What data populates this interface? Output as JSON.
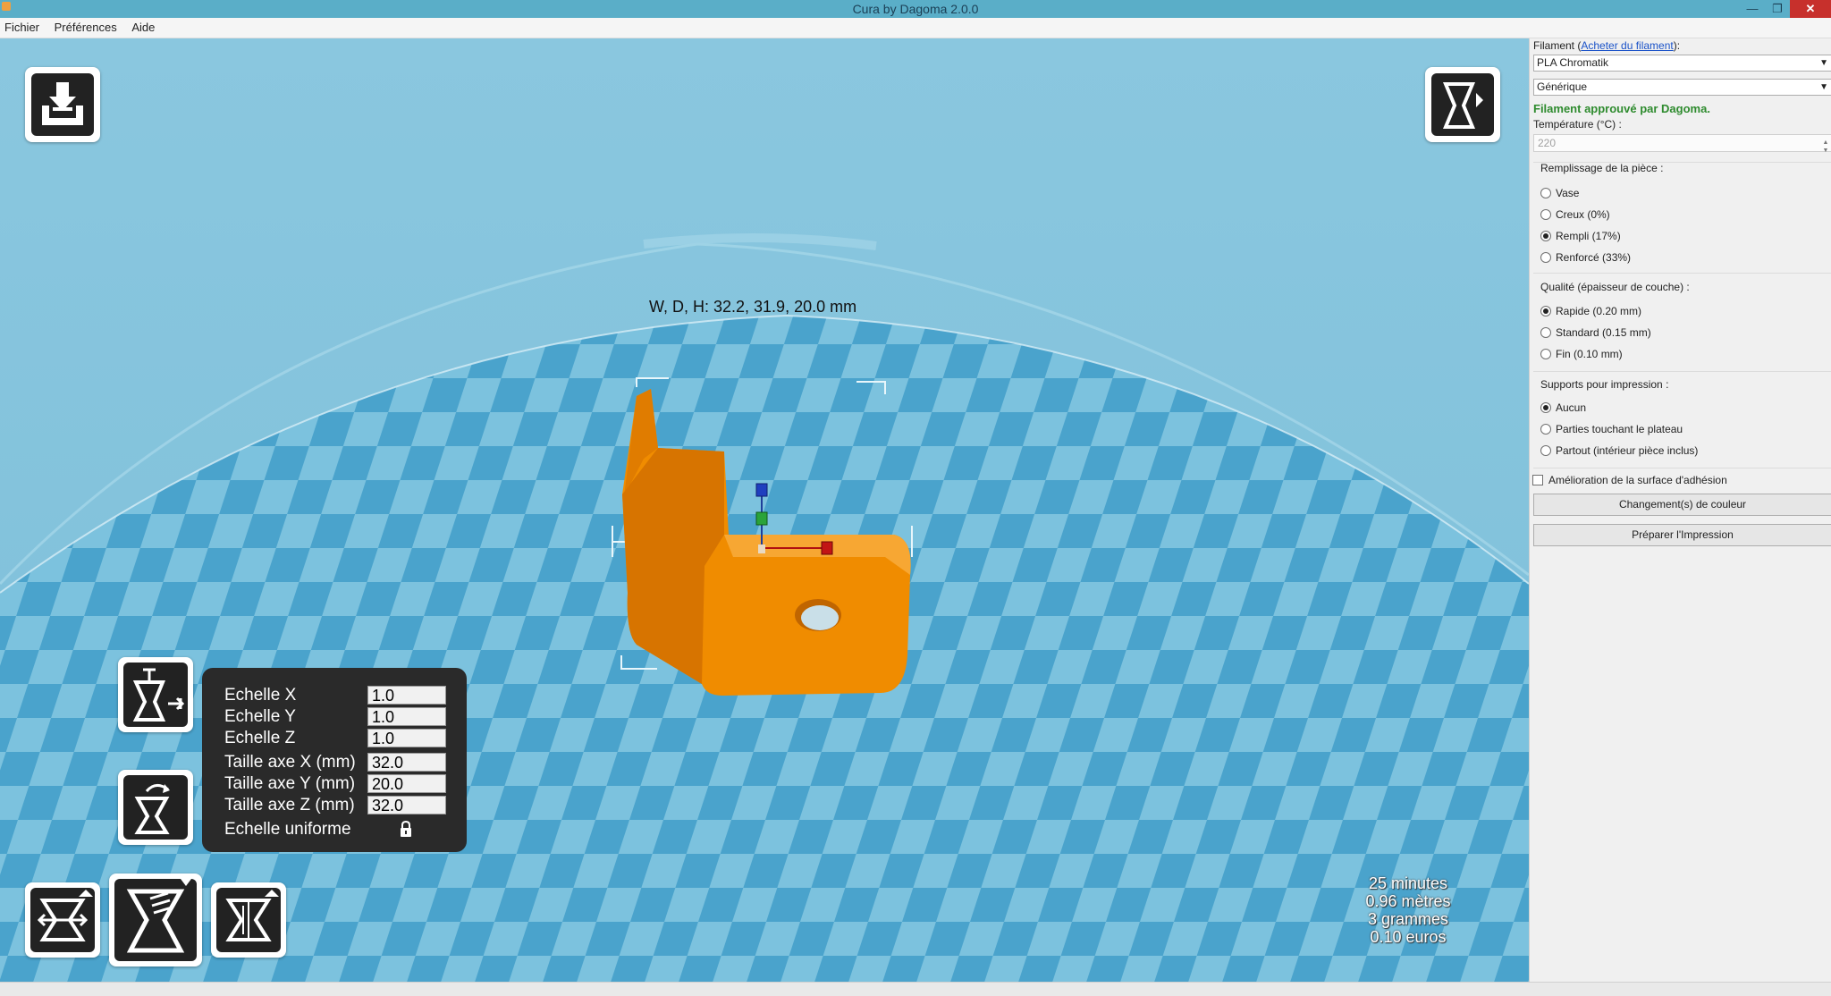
{
  "window": {
    "title": "Cura by Dagoma 2.0.0",
    "minimize": "—",
    "maximize": "❐",
    "close": "✕"
  },
  "menu": {
    "file": "Fichier",
    "preferences": "Préférences",
    "help": "Aide"
  },
  "viewport": {
    "dimensions_label": "W, D, H: 32.2, 31.9, 20.0 mm",
    "stats": {
      "time": "25 minutes",
      "length": "0.96 mètres",
      "weight": "3 grammes",
      "cost": "0.10 euros"
    }
  },
  "scale_panel": {
    "scale_x_label": "Echelle X",
    "scale_x_value": "1.0",
    "scale_y_label": "Echelle Y",
    "scale_y_value": "1.0",
    "scale_z_label": "Echelle Z",
    "scale_z_value": "1.0",
    "size_x_label": "Taille axe X (mm)",
    "size_x_value": "32.0",
    "size_y_label": "Taille axe Y (mm)",
    "size_y_value": "20.0",
    "size_z_label": "Taille axe Z (mm)",
    "size_z_value": "32.0",
    "uniform_label": "Echelle uniforme"
  },
  "sidepanel": {
    "filament_label_prefix": "Filament (",
    "filament_link": "Acheter du filament",
    "filament_label_suffix": "):",
    "filament_select": "PLA Chromatik",
    "color_select": "Générique",
    "approved_text": "Filament approuvé par Dagoma.",
    "temperature_label": "Température (°C) :",
    "temperature_value": "220",
    "infill": {
      "title": "Remplissage de la pièce :",
      "options": [
        "Vase",
        "Creux (0%)",
        "Rempli (17%)",
        "Renforcé (33%)"
      ],
      "selected": 2
    },
    "quality": {
      "title": "Qualité (épaisseur de couche) :",
      "options": [
        "Rapide (0.20 mm)",
        "Standard (0.15 mm)",
        "Fin (0.10 mm)"
      ],
      "selected": 0
    },
    "supports": {
      "title": "Supports pour impression :",
      "options": [
        "Aucun",
        "Parties touchant le plateau",
        "Partout (intérieur pièce inclus)"
      ],
      "selected": 0
    },
    "adhesion_label": "Amélioration de la surface d'adhésion",
    "adhesion_checked": false,
    "color_change_button": "Changement(s) de couleur",
    "prepare_button": "Préparer l'Impression"
  },
  "colors": {
    "accent_green": "#2e8b2e",
    "model_orange": "#f08c00",
    "close_red": "#c7302c"
  }
}
